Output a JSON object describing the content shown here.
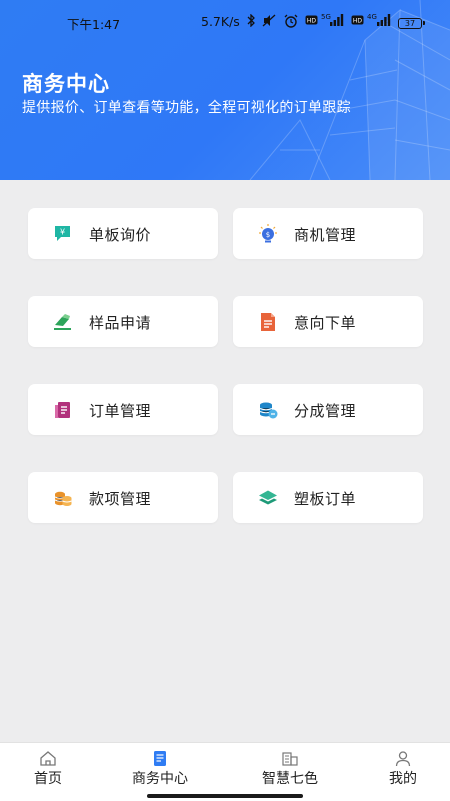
{
  "status_bar": {
    "time": "下午1:47",
    "speed": "5.7K/s",
    "network_1": "5G",
    "network_2": "4G",
    "battery": "37"
  },
  "header": {
    "title": "商务中心",
    "subtitle": "提供报价、订单查看等功能，全程可视化的订单跟踪"
  },
  "menu": [
    {
      "label": "单板询价",
      "icon": "price-tag-icon",
      "color": "#1fb6a4"
    },
    {
      "label": "商机管理",
      "icon": "lightbulb-icon",
      "color": "#3b6fe0"
    },
    {
      "label": "样品申请",
      "icon": "eraser-icon",
      "color": "#2da45a"
    },
    {
      "label": "意向下单",
      "icon": "document-icon",
      "color": "#e8643a"
    },
    {
      "label": "订单管理",
      "icon": "order-list-icon",
      "color": "#b2317c"
    },
    {
      "label": "分成管理",
      "icon": "coin-stack-icon",
      "color": "#1f86c9"
    },
    {
      "label": "款项管理",
      "icon": "coins-icon",
      "color": "#e9922a"
    },
    {
      "label": "塑板订单",
      "icon": "layers-icon",
      "color": "#34b693"
    }
  ],
  "tabbar": [
    {
      "label": "首页",
      "icon": "home-icon"
    },
    {
      "label": "商务中心",
      "icon": "business-center-icon"
    },
    {
      "label": "智慧七色",
      "icon": "building-icon"
    },
    {
      "label": "我的",
      "icon": "user-icon"
    }
  ],
  "colors": {
    "header_blue": "#2f7cf3",
    "active_tab": "#2f7cf3"
  }
}
